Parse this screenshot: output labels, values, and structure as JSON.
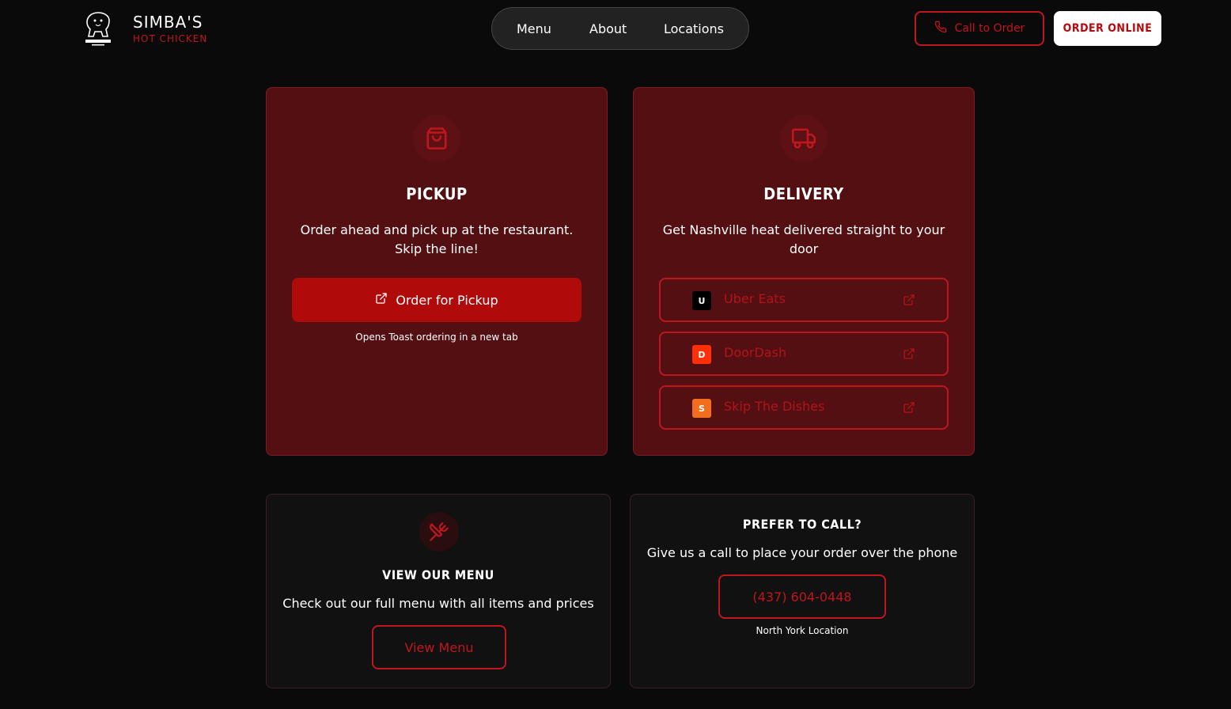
{
  "brand": {
    "name": "SIMBA'S",
    "subtitle": "HOT CHICKEN"
  },
  "nav": {
    "items": [
      "Menu",
      "About",
      "Locations"
    ]
  },
  "header_actions": {
    "call_label": "Call to Order",
    "order_label": "ORDER ONLINE"
  },
  "pickup": {
    "title": "PICKUP",
    "description": "Order ahead and pick up at the restaurant. Skip the line!",
    "button_label": "Order for Pickup",
    "note": "Opens Toast ordering in a new tab"
  },
  "delivery": {
    "title": "DELIVERY",
    "description": "Get Nashville heat delivered straight to your door",
    "services": [
      {
        "badge": "U",
        "label": "Uber Eats",
        "color": "#000000"
      },
      {
        "badge": "D",
        "label": "DoorDash",
        "color": "#ff3008"
      },
      {
        "badge": "S",
        "label": "Skip The Dishes",
        "color": "#f36d1f"
      }
    ]
  },
  "menu_card": {
    "title": "VIEW OUR MENU",
    "description": "Check out our full menu with all items and prices",
    "button_label": "View Menu"
  },
  "call_card": {
    "title": "PREFER TO CALL?",
    "description": "Give us a call to place your order over the phone",
    "phone": "(437) 604-0448",
    "location": "North York Location"
  },
  "colors": {
    "accent": "#c0161d",
    "card_red": "#530f12",
    "background": "#0a0a0a"
  },
  "icons": [
    "lion-logo-icon",
    "phone-icon",
    "shopping-bag-icon",
    "truck-icon",
    "external-link-icon",
    "utensils-icon"
  ]
}
